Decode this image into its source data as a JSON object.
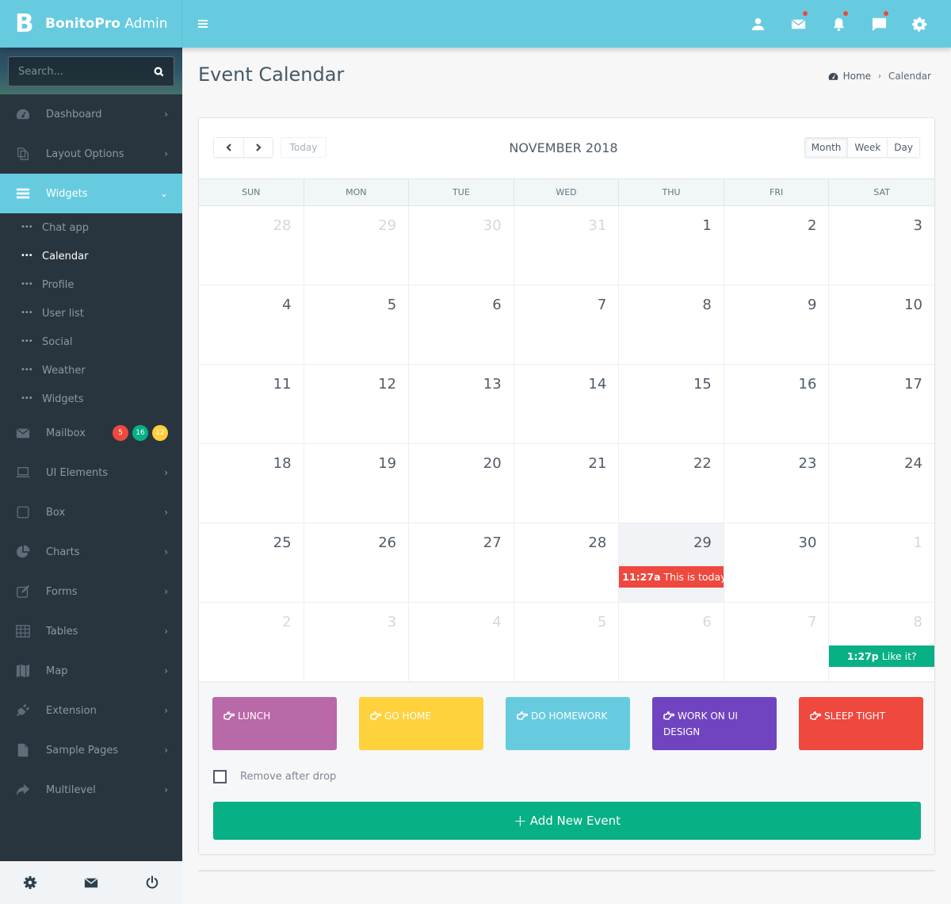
{
  "brand": {
    "mark": "B",
    "name_bold": "BonitoPro",
    "name_light": "Admin"
  },
  "topbar": {
    "icons": [
      {
        "name": "user-icon",
        "dot": false
      },
      {
        "name": "mail-icon",
        "dot": true
      },
      {
        "name": "bell-icon",
        "dot": true
      },
      {
        "name": "chat-icon",
        "dot": true
      },
      {
        "name": "gear-icon",
        "dot": false
      }
    ],
    "dot_color": "#ef483e"
  },
  "sidebar": {
    "search_placeholder": "Search...",
    "items": [
      {
        "label": "Dashboard",
        "icon": "dashboard-icon",
        "chevron": ">"
      },
      {
        "label": "Layout Options",
        "icon": "copy-icon",
        "chevron": ">"
      },
      {
        "label": "Widgets",
        "icon": "bars-icon",
        "chevron": "v",
        "active": true,
        "children": [
          "Chat app",
          "Calendar",
          "Profile",
          "User list",
          "Social",
          "Weather",
          "Widgets"
        ],
        "current_child": "Calendar"
      },
      {
        "label": "Mailbox",
        "icon": "envelope-icon",
        "badges": [
          {
            "value": "5",
            "color": "#ef483e"
          },
          {
            "value": "16",
            "color": "#07b085"
          },
          {
            "value": "12",
            "color": "#ffce3a"
          }
        ]
      },
      {
        "label": "UI Elements",
        "icon": "laptop-icon",
        "chevron": ">"
      },
      {
        "label": "Box",
        "icon": "square-icon",
        "chevron": ">"
      },
      {
        "label": "Charts",
        "icon": "pie-chart-icon",
        "chevron": ">"
      },
      {
        "label": "Forms",
        "icon": "edit-icon",
        "chevron": ">"
      },
      {
        "label": "Tables",
        "icon": "table-icon",
        "chevron": ">"
      },
      {
        "label": "Map",
        "icon": "map-icon",
        "chevron": ">"
      },
      {
        "label": "Extension",
        "icon": "plug-icon",
        "chevron": ">"
      },
      {
        "label": "Sample Pages",
        "icon": "file-icon",
        "chevron": ">"
      },
      {
        "label": "Multilevel",
        "icon": "share-icon",
        "chevron": ">"
      }
    ],
    "footer": [
      "settings-icon",
      "mail-icon",
      "power-icon"
    ]
  },
  "page": {
    "title": "Event Calendar",
    "breadcrumb": {
      "home": "Home",
      "current": "Calendar"
    }
  },
  "calendar": {
    "today_label": "Today",
    "month_title": "NOVEMBER 2018",
    "views": [
      "Month",
      "Week",
      "Day"
    ],
    "active_view": "Month",
    "weekdays": [
      "SUN",
      "MON",
      "TUE",
      "WED",
      "THU",
      "FRI",
      "SAT"
    ],
    "weeks": [
      [
        {
          "d": "28",
          "o": true
        },
        {
          "d": "29",
          "o": true
        },
        {
          "d": "30",
          "o": true
        },
        {
          "d": "31",
          "o": true
        },
        {
          "d": "1"
        },
        {
          "d": "2"
        },
        {
          "d": "3"
        }
      ],
      [
        {
          "d": "4"
        },
        {
          "d": "5"
        },
        {
          "d": "6"
        },
        {
          "d": "7"
        },
        {
          "d": "8"
        },
        {
          "d": "9"
        },
        {
          "d": "10"
        }
      ],
      [
        {
          "d": "11"
        },
        {
          "d": "12"
        },
        {
          "d": "13"
        },
        {
          "d": "14"
        },
        {
          "d": "15"
        },
        {
          "d": "16"
        },
        {
          "d": "17"
        }
      ],
      [
        {
          "d": "18"
        },
        {
          "d": "19"
        },
        {
          "d": "20"
        },
        {
          "d": "21"
        },
        {
          "d": "22"
        },
        {
          "d": "23"
        },
        {
          "d": "24"
        }
      ],
      [
        {
          "d": "25"
        },
        {
          "d": "26"
        },
        {
          "d": "27"
        },
        {
          "d": "28"
        },
        {
          "d": "29",
          "today": true,
          "event": {
            "time": "11:27a",
            "title": "This is today check date",
            "color": "#ef483e"
          }
        },
        {
          "d": "30"
        },
        {
          "d": "1",
          "o": true
        }
      ],
      [
        {
          "d": "2",
          "o": true
        },
        {
          "d": "3",
          "o": true
        },
        {
          "d": "4",
          "o": true
        },
        {
          "d": "5",
          "o": true
        },
        {
          "d": "6",
          "o": true
        },
        {
          "d": "7",
          "o": true
        },
        {
          "d": "8",
          "o": true,
          "event": {
            "time": "1:27p",
            "title": "Like it?",
            "color": "#07b085",
            "center": true
          }
        }
      ]
    ],
    "external_events": [
      {
        "label": "LUNCH",
        "color": "#b968a8"
      },
      {
        "label": "GO HOME",
        "color": "#ffd13d"
      },
      {
        "label": "DO HOMEWORK",
        "color": "#67cbe0"
      },
      {
        "label": "WORK ON UI DESIGN",
        "color": "#7044c0"
      },
      {
        "label": "SLEEP TIGHT",
        "color": "#ef483e"
      }
    ],
    "remove_after_drop": {
      "label": "Remove after drop",
      "checked": false
    },
    "add_button": {
      "plus": "+",
      "label": "Add New Event",
      "color": "#07b085"
    }
  }
}
